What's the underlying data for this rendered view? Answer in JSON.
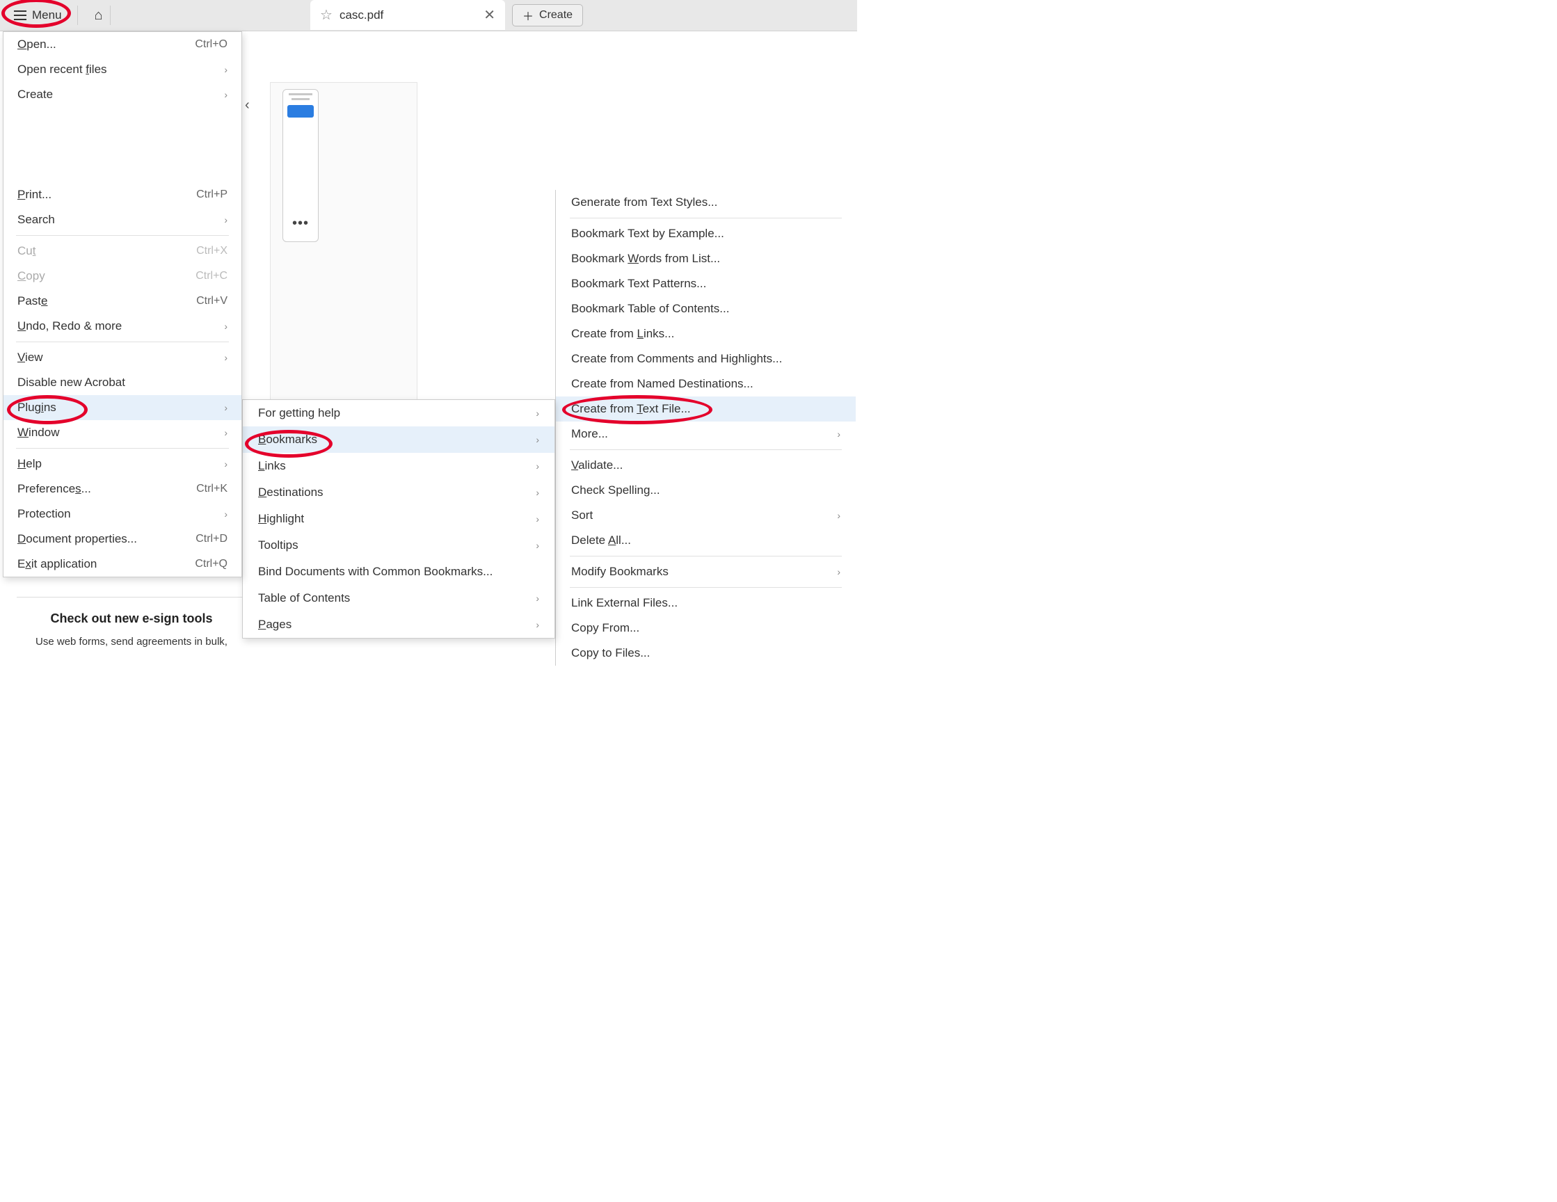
{
  "toolbar": {
    "menu_label": "Menu",
    "tab_title": "casc.pdf",
    "create_label": "Create"
  },
  "menu": {
    "open": "Open...",
    "open_shortcut": "Ctrl+O",
    "open_recent": "Open recent files",
    "create": "Create",
    "print": "Print...",
    "print_shortcut": "Ctrl+P",
    "search": "Search",
    "cut": "Cut",
    "cut_shortcut": "Ctrl+X",
    "copy": "Copy",
    "copy_shortcut": "Ctrl+C",
    "paste": "Paste",
    "paste_shortcut": "Ctrl+V",
    "undo_redo": "Undo, Redo & more",
    "view": "View",
    "disable_new": "Disable new Acrobat",
    "plugins": "Plugins",
    "window": "Window",
    "help": "Help",
    "preferences": "Preferences...",
    "preferences_shortcut": "Ctrl+K",
    "protection": "Protection",
    "doc_props": "Document properties...",
    "doc_props_shortcut": "Ctrl+D",
    "exit": "Exit application",
    "exit_shortcut": "Ctrl+Q"
  },
  "submenu2": {
    "help": "For getting help",
    "bookmarks": "Bookmarks",
    "links": "Links",
    "destinations": "Destinations",
    "highlight": "Highlight",
    "tooltips": "Tooltips",
    "bind": "Bind Documents with Common Bookmarks...",
    "toc": "Table of Contents",
    "pages": "Pages"
  },
  "submenu3": {
    "gen_styles": "Generate from Text Styles...",
    "by_example": "Bookmark Text by Example...",
    "words_list": "Bookmark Words from List...",
    "text_patterns": "Bookmark Text Patterns...",
    "toc": "Bookmark Table of Contents...",
    "from_links": "Create from Links...",
    "from_comments": "Create from Comments and Highlights...",
    "from_named": "Create from Named Destinations...",
    "from_textfile": "Create from Text File...",
    "more": "More...",
    "validate": "Validate...",
    "check_spelling": "Check Spelling...",
    "sort": "Sort",
    "delete_all": "Delete All...",
    "modify": "Modify Bookmarks",
    "link_external": "Link External Files...",
    "copy_from": "Copy From...",
    "copy_to": "Copy to Files..."
  },
  "esign": {
    "title": "Check out new e-sign tools",
    "sub": "Use web forms, send agreements in bulk,"
  }
}
